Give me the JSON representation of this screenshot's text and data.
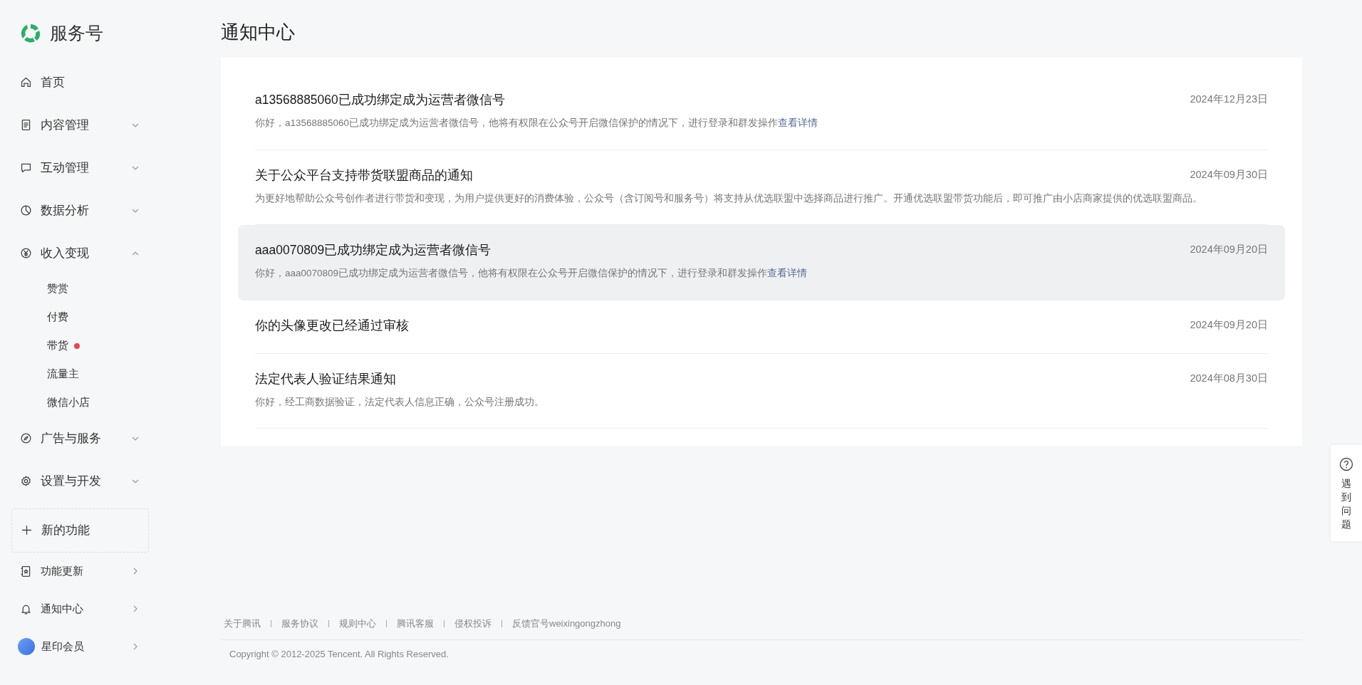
{
  "sidebar": {
    "brand": "服务号",
    "nav": [
      {
        "label": "首页"
      },
      {
        "label": "内容管理",
        "expanded": false
      },
      {
        "label": "互动管理",
        "expanded": false
      },
      {
        "label": "数据分析",
        "expanded": false
      },
      {
        "label": "收入变现",
        "expanded": true,
        "children": [
          {
            "label": "赞赏",
            "dot": false
          },
          {
            "label": "付费",
            "dot": false
          },
          {
            "label": "带货",
            "dot": true
          },
          {
            "label": "流量主",
            "dot": false
          },
          {
            "label": "微信小店",
            "dot": false
          }
        ]
      },
      {
        "label": "广告与服务",
        "expanded": false
      },
      {
        "label": "设置与开发",
        "expanded": false
      }
    ],
    "new_feature": "新的功能",
    "links": [
      {
        "label": "功能更新"
      },
      {
        "label": "通知中心"
      },
      {
        "label": "星印会员"
      }
    ]
  },
  "page_title": "通知中心",
  "notifications": [
    {
      "title": "a13568885060已成功绑定成为运营者微信号",
      "date": "2024年12月23日",
      "summary": "你好，a13568885060已成功绑定成为运营者微信号，他将有权限在公众号开启微信保护的情况下，进行登录和群发操作",
      "link": "查看详情",
      "highlighted": false
    },
    {
      "title": "关于公众平台支持带货联盟商品的通知",
      "date": "2024年09月30日",
      "summary": "为更好地帮助公众号创作者进行带货和变现，为用户提供更好的消费体验，公众号（含订阅号和服务号）将支持从优选联盟中选择商品进行推广。开通优选联盟带货功能后，即可推广由小店商家提供的优选联盟商品。",
      "highlighted": false
    },
    {
      "title": "aaa0070809已成功绑定成为运营者微信号",
      "date": "2024年09月20日",
      "summary": "你好，aaa0070809已成功绑定成为运营者微信号，他将有权限在公众号开启微信保护的情况下，进行登录和群发操作",
      "link": "查看详情",
      "highlighted": true
    },
    {
      "title": "你的头像更改已经通过审核",
      "date": "2024年09月20日",
      "highlighted": false
    },
    {
      "title": "法定代表人验证结果通知",
      "date": "2024年08月30日",
      "summary": "你好，经工商数据验证，法定代表人信息正确，公众号注册成功。",
      "highlighted": false
    }
  ],
  "footer": {
    "links": [
      "关于腾讯",
      "服务协议",
      "规则中心",
      "腾讯客服",
      "侵权投诉",
      "反馈官号weixingongzhong"
    ],
    "copyright": "Copyright © 2012-2025 Tencent. All Rights Reserved."
  },
  "help": "遇到问题"
}
